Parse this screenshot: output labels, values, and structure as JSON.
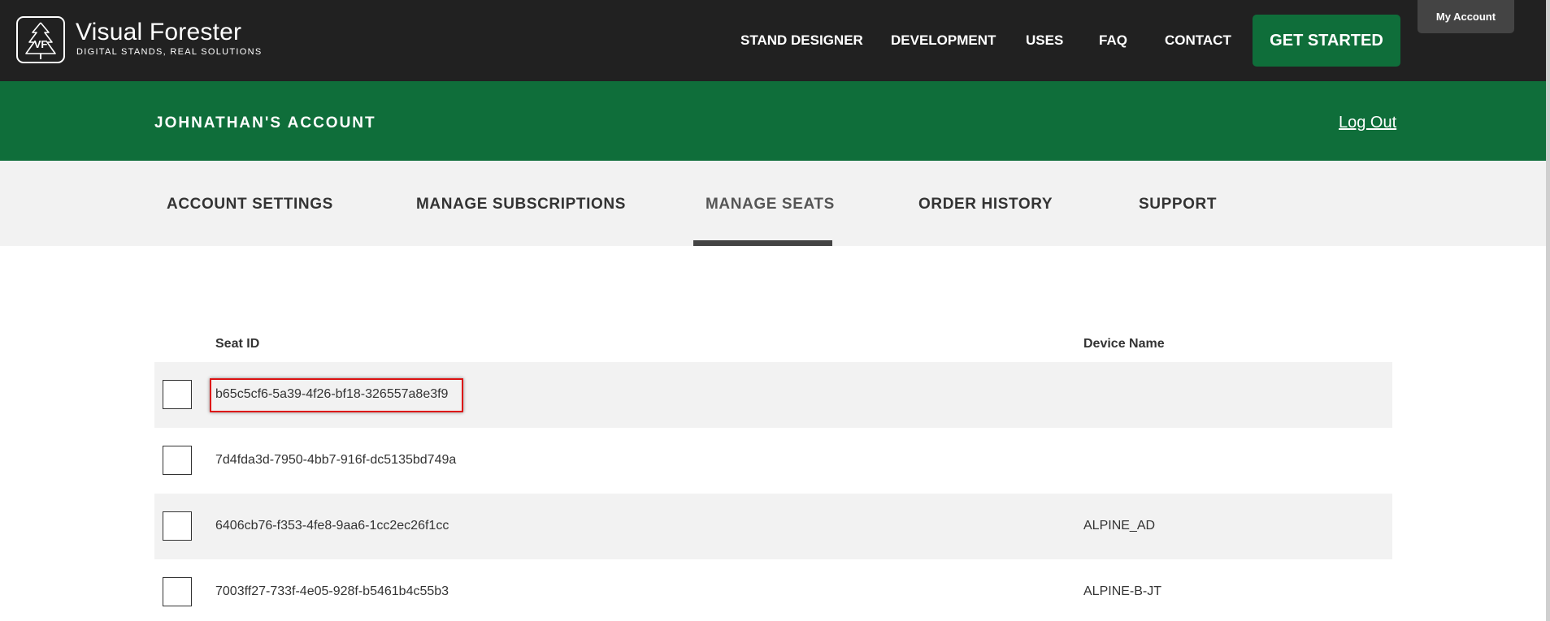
{
  "header": {
    "brand_name": "Visual Forester",
    "brand_tagline": "DIGITAL STANDS, REAL SOLUTIONS",
    "logo_letters": "VF",
    "nav": [
      {
        "label": "STAND DESIGNER"
      },
      {
        "label": "DEVELOPMENT"
      },
      {
        "label": "USES"
      },
      {
        "label": "FAQ"
      },
      {
        "label": "CONTACT"
      }
    ],
    "cta_label": "GET STARTED",
    "my_account_label": "My Account"
  },
  "banner": {
    "title": "JOHNATHAN'S ACCOUNT",
    "logout_label": "Log Out"
  },
  "tabs": [
    {
      "label": "ACCOUNT SETTINGS"
    },
    {
      "label": "MANAGE SUBSCRIPTIONS"
    },
    {
      "label": "MANAGE SEATS"
    },
    {
      "label": "ORDER HISTORY"
    },
    {
      "label": "SUPPORT"
    }
  ],
  "active_tab": "MANAGE SEATS",
  "table": {
    "headers": {
      "seat_id": "Seat ID",
      "device_name": "Device Name"
    },
    "rows": [
      {
        "seat_id": "b65c5cf6-5a39-4f26-bf18-326557a8e3f9",
        "device_name": "",
        "checked": false,
        "highlighted": true
      },
      {
        "seat_id": "7d4fda3d-7950-4bb7-916f-dc5135bd749a",
        "device_name": "",
        "checked": false,
        "highlighted": false
      },
      {
        "seat_id": "6406cb76-f353-4fe8-9aa6-1cc2ec26f1cc",
        "device_name": "ALPINE_AD",
        "checked": false,
        "highlighted": false
      },
      {
        "seat_id": "7003ff27-733f-4e05-928f-b5461b4c55b3",
        "device_name": "ALPINE-B-JT",
        "checked": false,
        "highlighted": false
      }
    ]
  },
  "colors": {
    "nav_bg": "#212121",
    "brand_green": "#0f6e3a",
    "tab_bg": "#f2f2f2",
    "highlight_red": "#dd1111"
  },
  "icons": {
    "logo": "tree-logo-icon"
  }
}
